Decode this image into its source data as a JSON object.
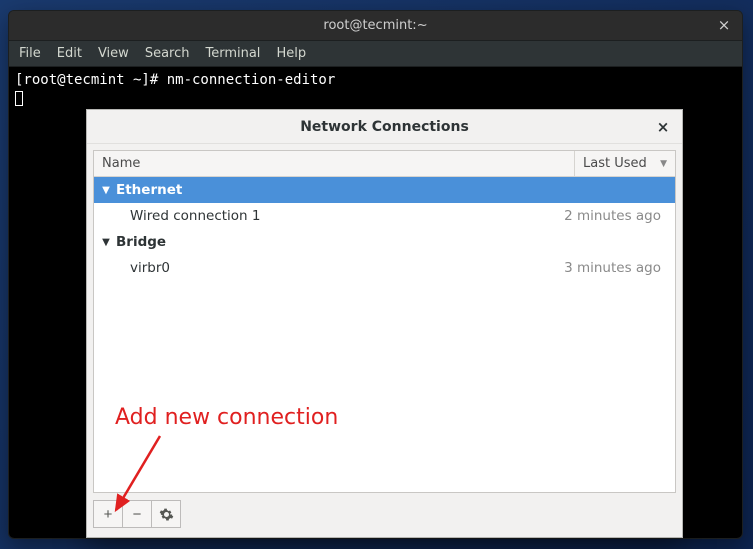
{
  "terminal": {
    "title": "root@tecmint:~",
    "menu": {
      "file": "File",
      "edit": "Edit",
      "view": "View",
      "search": "Search",
      "terminal": "Terminal",
      "help": "Help"
    },
    "prompt_line": "[root@tecmint ~]# nm-connection-editor"
  },
  "dialog": {
    "title": "Network Connections",
    "columns": {
      "name": "Name",
      "last_used": "Last Used"
    },
    "groups": [
      {
        "label": "Ethernet",
        "expanded": true,
        "selected": true,
        "items": [
          {
            "name": "Wired connection 1",
            "last_used": "2 minutes ago"
          }
        ]
      },
      {
        "label": "Bridge",
        "expanded": true,
        "selected": false,
        "items": [
          {
            "name": "virbr0",
            "last_used": "3 minutes ago"
          }
        ]
      }
    ],
    "toolbar": {
      "add": "+",
      "remove": "−",
      "settings": "gear"
    }
  },
  "annotation": {
    "label": "Add new connection"
  }
}
